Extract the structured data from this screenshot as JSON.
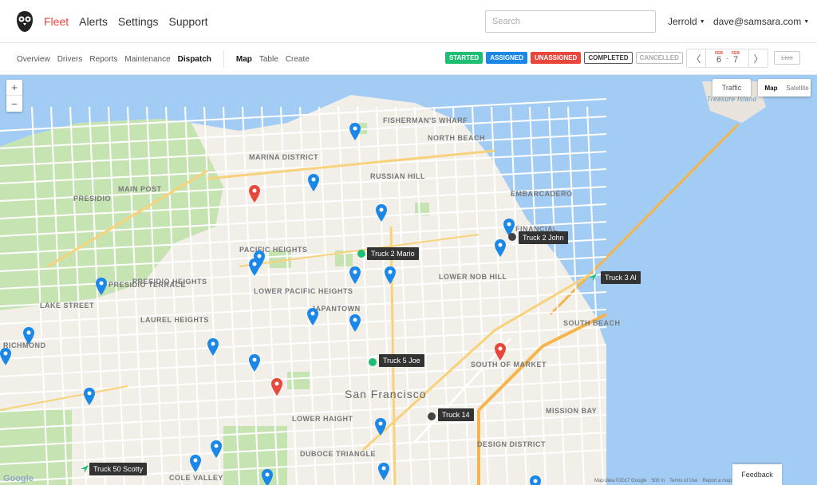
{
  "nav": {
    "items": [
      {
        "label": "Fleet",
        "active": true
      },
      {
        "label": "Alerts",
        "active": false
      },
      {
        "label": "Settings",
        "active": false
      },
      {
        "label": "Support",
        "active": false
      }
    ],
    "search_placeholder": "Search",
    "org": "Jerrold",
    "email": "dave@samsara.com"
  },
  "subnav": {
    "left": [
      {
        "label": "Overview",
        "active": false
      },
      {
        "label": "Drivers",
        "active": false
      },
      {
        "label": "Reports",
        "active": false
      },
      {
        "label": "Maintenance",
        "active": false
      },
      {
        "label": "Dispatch",
        "active": true
      }
    ],
    "right": [
      {
        "label": "Map",
        "active": true
      },
      {
        "label": "Table",
        "active": false
      },
      {
        "label": "Create",
        "active": false
      }
    ]
  },
  "filters": [
    {
      "label": "STARTED",
      "bg": "#1fbf73",
      "fg": "#ffffff",
      "border": "#1fbf73"
    },
    {
      "label": "ASSIGNED",
      "bg": "#1b88e8",
      "fg": "#ffffff",
      "border": "#1b88e8"
    },
    {
      "label": "UNASSIGNED",
      "bg": "#e9473c",
      "fg": "#ffffff",
      "border": "#e9473c"
    },
    {
      "label": "COMPLETED",
      "bg": "#ffffff",
      "fg": "#333333",
      "border": "#555555"
    },
    {
      "label": "CANCELLED",
      "bg": "#ffffff",
      "fg": "#aaaaaa",
      "border": "#bbbbbb"
    }
  ],
  "date_range": {
    "start_month": "FEB",
    "start_day": "6",
    "end_month": "FEB",
    "end_day": "7",
    "dash": "-"
  },
  "live_label": "Live",
  "map": {
    "traffic_label": "Traffic",
    "type_map": "Map",
    "type_satellite": "Satellite",
    "zoom_in": "+",
    "zoom_out": "−",
    "city_label": "San Francisco",
    "labels": [
      "FISHERMAN'S WHARF",
      "NORTH BEACH",
      "MARINA DISTRICT",
      "RUSSIAN HILL",
      "EMBARCADERO",
      "PRESIDIO",
      "MAIN POST",
      "PACIFIC HEIGHTS",
      "PRESIDIO HEIGHTS",
      "LOWER PACIFIC HEIGHTS",
      "JAPANTOWN",
      "LOWER NOB HILL",
      "LAKE STREET",
      "LAUREL HEIGHTS",
      "RICHMOND",
      "SOUTH BEACH",
      "SOUTH OF MARKET",
      "LOWER HAIGHT",
      "MISSION BAY",
      "DESIGN DISTRICT",
      "DUBOCE TRIANGLE",
      "COLE VALLEY",
      "FINANCIAL",
      "PRESIDIO TERRACE",
      "Treasure Island"
    ],
    "trucks": [
      {
        "name": "Truck 2 Mario",
        "status": "started"
      },
      {
        "name": "Truck 2 John",
        "status": "completed"
      },
      {
        "name": "Truck 3 Al",
        "status": "started"
      },
      {
        "name": "Truck 5 Joe",
        "status": "started"
      },
      {
        "name": "Truck 14",
        "status": "completed"
      },
      {
        "name": "Truck 50 Scotty",
        "status": "started"
      }
    ],
    "attribution": [
      "Map data ©2017 Google",
      "500 m",
      "Terms of Use",
      "Report a map error"
    ],
    "google_mark": "Google"
  },
  "feedback_label": "Feedback",
  "colors": {
    "accent": "#e9473c",
    "assigned_pin": "#1b88e8",
    "unassigned_pin": "#e9473c",
    "started_dot": "#1fbf73",
    "completed_dot": "#444444",
    "water": "#a3ccf4",
    "park": "#c6e3b2"
  }
}
